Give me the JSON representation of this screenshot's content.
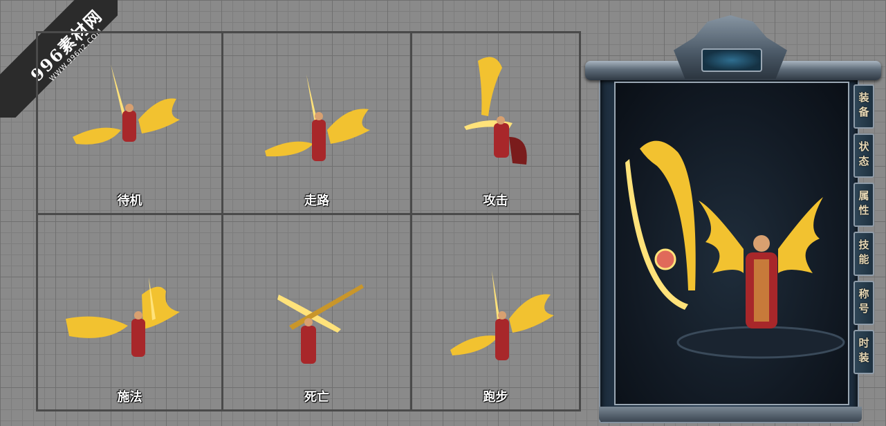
{
  "watermark": {
    "main": "996素材网",
    "url": "WWW.996n2.COM"
  },
  "animations": [
    {
      "label": "待机"
    },
    {
      "label": "走路"
    },
    {
      "label": "攻击"
    },
    {
      "label": "施法"
    },
    {
      "label": "死亡"
    },
    {
      "label": "跑步"
    }
  ],
  "side_tabs": [
    {
      "label": "装备"
    },
    {
      "label": "状态"
    },
    {
      "label": "属性"
    },
    {
      "label": "技能"
    },
    {
      "label": "称号"
    },
    {
      "label": "时装"
    }
  ],
  "colors": {
    "gold": "#f2c230",
    "gold_light": "#ffe27a",
    "robe_red": "#a8272a",
    "panel_blue": "#1d2d3d"
  }
}
